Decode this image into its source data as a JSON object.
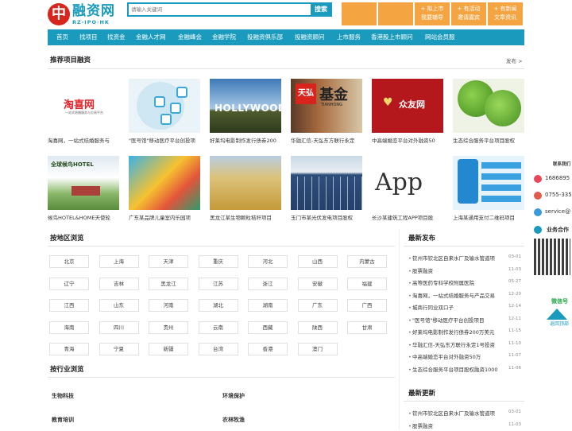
{
  "header": {
    "logo_mark": "中",
    "logo_text": "融资网",
    "logo_sub": "RZ-IPO·HK",
    "search_placeholder": "请输入关键词",
    "search_button": "搜索",
    "buttons": [
      {
        "l1": "",
        "l2": ""
      },
      {
        "l1": "",
        "l2": ""
      },
      {
        "l1": "+ 拟上市",
        "l2": "我要辅导"
      },
      {
        "l1": "+ 有活动",
        "l2": "邀请嘉宾"
      },
      {
        "l1": "+ 有新闻",
        "l2": "文章资讯"
      }
    ]
  },
  "nav": [
    "首页",
    "找项目",
    "找资金",
    "金融人才网",
    "金融峰会",
    "金融学院",
    "投融资俱乐部",
    "投融资顾问",
    "上市服务",
    "香港股上市顾问",
    "网站会员服"
  ],
  "recommend": {
    "title": "推荐项目融资",
    "more": "发布 >",
    "row1": [
      {
        "name": "淘喜网，一站式结婚服务与"
      },
      {
        "name": "\"医号馆\"移动医疗平台创投项"
      },
      {
        "name": "好莱坞电影制作发行债券200"
      },
      {
        "name": "华融汇信-天弘东方联行永定"
      },
      {
        "name": "中高端婚恋平台对外融资50"
      },
      {
        "name": "生态综合服务平台项目股权"
      }
    ],
    "row2": [
      {
        "name": "候鸟HOTEL&HOME天使轮"
      },
      {
        "name": "广东某品牌儿童室内乐园项"
      },
      {
        "name": "黑龙江某生物颗粒秸秆项目"
      },
      {
        "name": "玉门市某光伏发电项目股权"
      },
      {
        "name": "长沙某建筑工程APP项目股"
      },
      {
        "name": "上海某通用支付二维码项目"
      }
    ],
    "thumb_text": {
      "t1a": "淘喜网",
      "t1b": "一站式结婚服务与交易平台",
      "t3": "HOLLYWOOD",
      "t4a": "天弘",
      "t4b": "基金",
      "t4c": "TIANHONG",
      "t5": "众友网",
      "t7": "全球候鸟HOTEL",
      "t11": "App"
    }
  },
  "region": {
    "title": "按地区浏览",
    "items": [
      "北京",
      "上海",
      "天津",
      "重庆",
      "河北",
      "山西",
      "内蒙古",
      "辽宁",
      "吉林",
      "黑龙江",
      "江苏",
      "浙江",
      "安徽",
      "福建",
      "江西",
      "山东",
      "河南",
      "湖北",
      "湖南",
      "广东",
      "广西",
      "海南",
      "四川",
      "贵州",
      "云南",
      "西藏",
      "陕西",
      "甘肃",
      "青海",
      "宁夏",
      "新疆",
      "台湾",
      "香港",
      "澳门"
    ]
  },
  "industry": {
    "title": "按行业浏览",
    "items": [
      "生物科技",
      "环境保护",
      "教育培训",
      "农林牧渔"
    ]
  },
  "latest": {
    "title": "最新发布",
    "items": [
      {
        "t": "钦州市钦北区自来水厂及输水管道项",
        "d": "03-01"
      },
      {
        "t": "股票融资",
        "d": "11-03"
      },
      {
        "t": "高等医药专科学校附属医院",
        "d": "05-27"
      },
      {
        "t": "淘喜网，一站式结婚服务与产品交易",
        "d": "12-20"
      },
      {
        "t": "城商行同业双口子",
        "d": "12-14"
      },
      {
        "t": "\"医号馆\"移动医疗平台创投项目",
        "d": "12-11"
      },
      {
        "t": "好莱坞电影制作发行债券200万美元",
        "d": "11-15"
      },
      {
        "t": "华融汇信-天弘东方联行永定1号投资",
        "d": "11-10"
      },
      {
        "t": "中高端婚恋平台对外融资50万",
        "d": "11-07"
      },
      {
        "t": "生态综合服务平台项目股权融资1000",
        "d": "11-06"
      }
    ]
  },
  "updated": {
    "title": "最新更新",
    "items": [
      {
        "t": "钦州市钦北区自来水厂及输水管道项",
        "d": "03-01"
      },
      {
        "t": "股票融资",
        "d": "11-03"
      }
    ]
  },
  "contact": {
    "title": "联系我们",
    "phone": "1686895",
    "tel": "0755-335",
    "email": "service@",
    "biz": "业务合作",
    "wechat": "微信号",
    "back": "返回顶部"
  },
  "colors": {
    "brand": "#1a9bbd",
    "accent": "#f5a442",
    "logo_red": "#d7261e"
  }
}
